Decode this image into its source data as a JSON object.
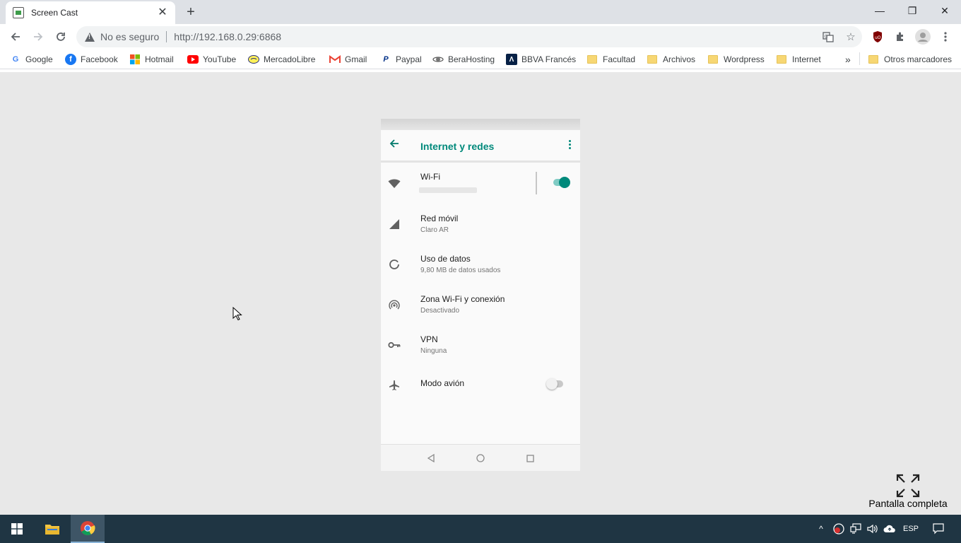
{
  "browser": {
    "tab": {
      "title": "Screen Cast"
    },
    "window_controls": {
      "minimize": "—",
      "restore": "❐",
      "close": "✕"
    },
    "toolbar": {
      "security_label": "No es seguro",
      "url": "http://192.168.0.29:6868"
    },
    "bookmarks": [
      {
        "label": "Google",
        "icon": "google-icon"
      },
      {
        "label": "Facebook",
        "icon": "facebook-icon"
      },
      {
        "label": "Hotmail",
        "icon": "hotmail-icon"
      },
      {
        "label": "YouTube",
        "icon": "youtube-icon"
      },
      {
        "label": "MercadoLibre",
        "icon": "mercadolibre-icon"
      },
      {
        "label": "Gmail",
        "icon": "gmail-icon"
      },
      {
        "label": "Paypal",
        "icon": "paypal-icon"
      },
      {
        "label": "BeraHosting",
        "icon": "berahosting-icon"
      },
      {
        "label": "BBVA Francés",
        "icon": "bbva-icon"
      },
      {
        "label": "Facultad",
        "icon": "folder-icon"
      },
      {
        "label": "Archivos",
        "icon": "folder-icon"
      },
      {
        "label": "Wordpress",
        "icon": "folder-icon"
      },
      {
        "label": "Internet",
        "icon": "folder-icon"
      }
    ],
    "bookmarks_overflow": "»",
    "other_bookmarks": "Otros marcadores"
  },
  "phone": {
    "appbar_title": "Internet y redes",
    "settings": [
      {
        "title": "Wi-Fi",
        "subtitle": "",
        "icon": "wifi-icon",
        "toggle": true
      },
      {
        "title": "Red móvil",
        "subtitle": "Claro AR",
        "icon": "cellular-signal-icon"
      },
      {
        "title": "Uso de datos",
        "subtitle": "9,80 MB de datos usados",
        "icon": "data-usage-icon"
      },
      {
        "title": "Zona Wi-Fi y conexión",
        "subtitle": "Desactivado",
        "icon": "hotspot-icon"
      },
      {
        "title": "VPN",
        "subtitle": "Ninguna",
        "icon": "vpn-key-icon"
      },
      {
        "title": "Modo avión",
        "subtitle": "",
        "icon": "airplane-icon",
        "toggle": false
      }
    ],
    "accent_color": "#00897b"
  },
  "fullscreen": {
    "label": "Pantalla completa"
  },
  "taskbar": {
    "language": "ESP",
    "background": "#1f3543"
  }
}
